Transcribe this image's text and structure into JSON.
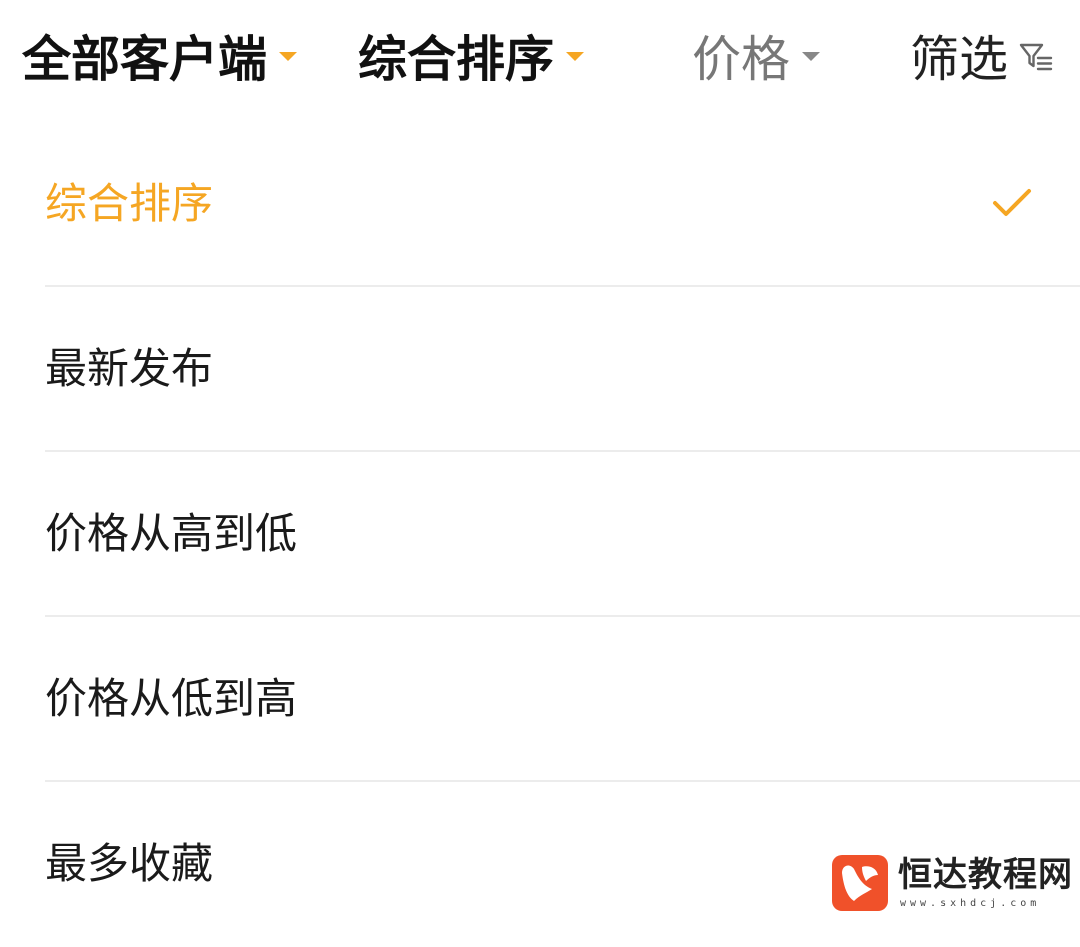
{
  "colors": {
    "accent": "#F5A623",
    "text_primary": "#1a1a1a",
    "text_muted": "#777777",
    "divider": "#ececec",
    "watermark_logo": "#F0512A"
  },
  "filter_bar": {
    "tabs": [
      {
        "label": "全部客户端",
        "icon": "caret-down-icon",
        "caret_color": "orange",
        "active": true
      },
      {
        "label": "综合排序",
        "icon": "caret-down-icon",
        "caret_color": "orange",
        "active": true
      },
      {
        "label": "价格",
        "icon": "caret-down-icon",
        "caret_color": "gray",
        "active": false
      },
      {
        "label": "筛选",
        "icon": "funnel-icon",
        "active": false
      }
    ]
  },
  "sort_menu": {
    "options": [
      {
        "label": "综合排序",
        "selected": true,
        "icon": "check-icon"
      },
      {
        "label": "最新发布",
        "selected": false
      },
      {
        "label": "价格从高到低",
        "selected": false
      },
      {
        "label": "价格从低到高",
        "selected": false
      },
      {
        "label": "最多收藏",
        "selected": false
      }
    ]
  },
  "watermark": {
    "text": "恒达教程网",
    "subtext": "www.sxhdcj.com",
    "icon": "heart-fish-logo-icon"
  }
}
